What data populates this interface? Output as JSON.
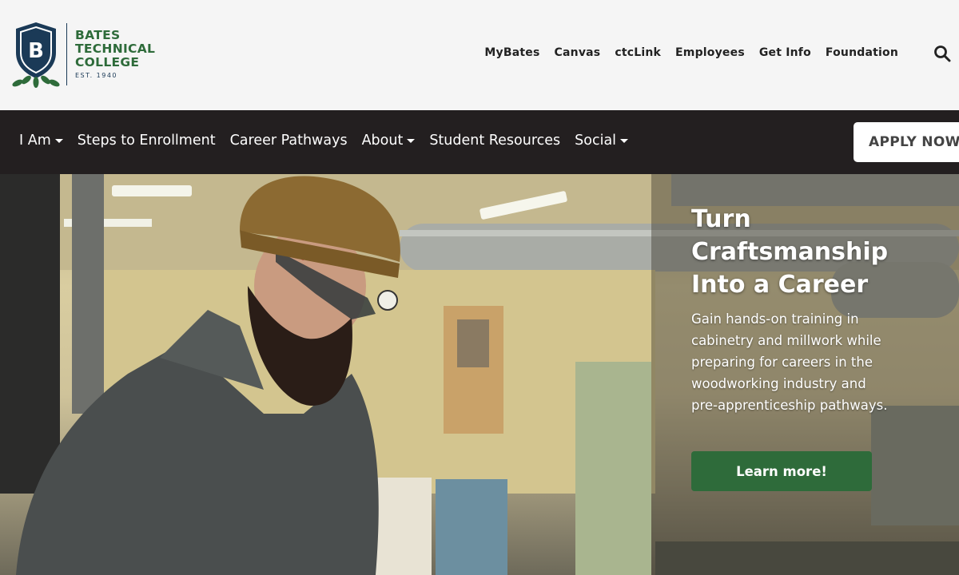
{
  "brand": {
    "name_lines": [
      "BATES",
      "TECHNICAL",
      "COLLEGE"
    ],
    "established": "EST. 1940",
    "shield_letter": "B"
  },
  "utility_nav": [
    "MyBates",
    "Canvas",
    "ctcLink",
    "Employees",
    "Get Info",
    "Foundation"
  ],
  "main_nav": [
    {
      "label": "I Am",
      "dropdown": true
    },
    {
      "label": "Steps to Enrollment",
      "dropdown": false
    },
    {
      "label": "Career Pathways",
      "dropdown": false
    },
    {
      "label": "About",
      "dropdown": true
    },
    {
      "label": "Student Resources",
      "dropdown": false
    },
    {
      "label": "Social",
      "dropdown": true
    }
  ],
  "apply_button": "APPLY NOW",
  "hero": {
    "title_lines": [
      "Turn",
      "Craftsmanship",
      "Into a Career"
    ],
    "description": "Gain hands-on training in cabinetry and millwork while preparing for careers in the woodworking industry and pre-apprenticeship pathways.",
    "cta": "Learn more!"
  },
  "colors": {
    "brand_green": "#2e6b3a",
    "brand_navy": "#1b3a57",
    "nav_bg": "#231f20"
  },
  "icons": {
    "search": "search-icon",
    "dropdown": "caret-down-icon"
  }
}
